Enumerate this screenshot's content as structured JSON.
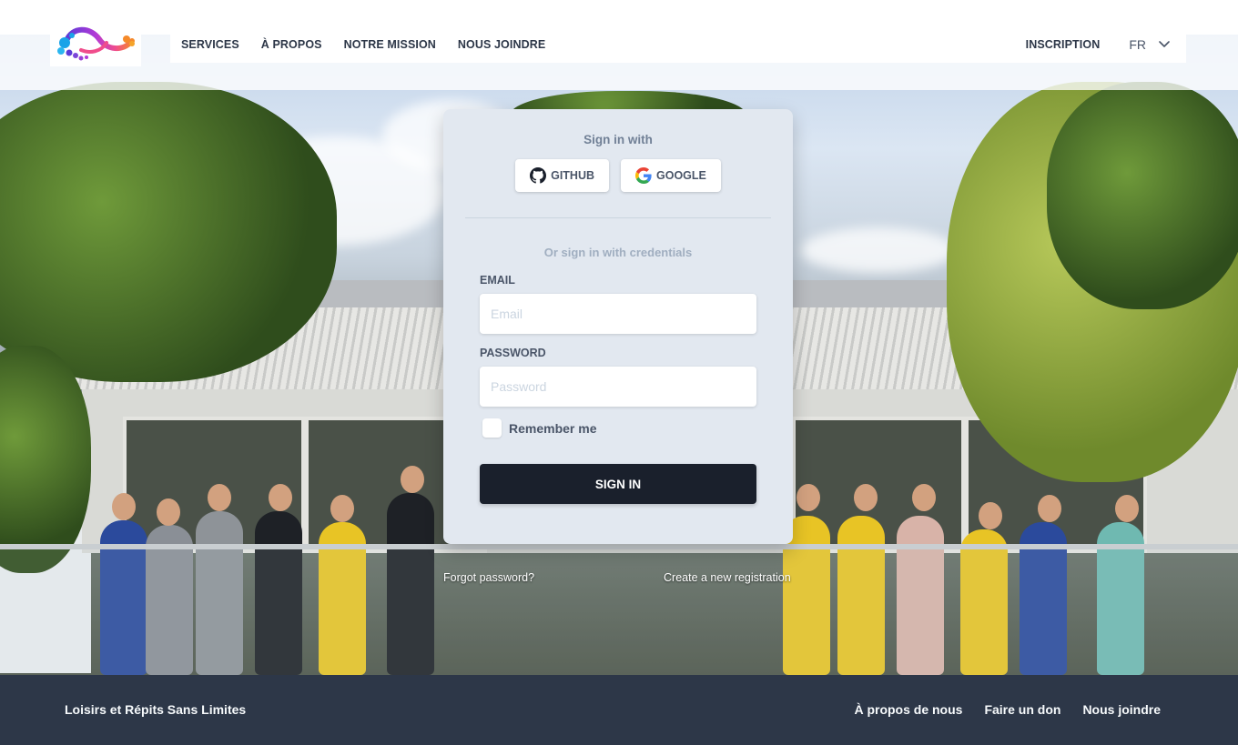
{
  "brand": {
    "colors": {
      "accent_dark": "#1a202c",
      "card_bg": "#e2e8f0",
      "footer_bg": "#2d3748"
    }
  },
  "nav": {
    "items": [
      {
        "label": "SERVICES"
      },
      {
        "label": "À PROPOS"
      },
      {
        "label": "NOTRE MISSION"
      },
      {
        "label": "NOUS JOINDRE"
      }
    ],
    "register_label": "INSCRIPTION",
    "language": "FR"
  },
  "signin": {
    "heading": "Sign in with",
    "providers": [
      {
        "label": "GITHUB",
        "icon": "github-icon"
      },
      {
        "label": "GOOGLE",
        "icon": "google-icon"
      }
    ],
    "alt_heading": "Or sign in with credentials",
    "email": {
      "label": "EMAIL",
      "placeholder": "Email",
      "value": ""
    },
    "password": {
      "label": "PASSWORD",
      "placeholder": "Password",
      "value": ""
    },
    "remember_label": "Remember me",
    "remember_checked": false,
    "submit_label": "SIGN IN"
  },
  "links": {
    "forgot": "Forgot password?",
    "register": "Create a new registration"
  },
  "footer": {
    "brand": "Loisirs et Répits Sans Limites",
    "links": [
      {
        "label": "À propos de nous"
      },
      {
        "label": "Faire un don"
      },
      {
        "label": "Nous joindre"
      }
    ]
  }
}
